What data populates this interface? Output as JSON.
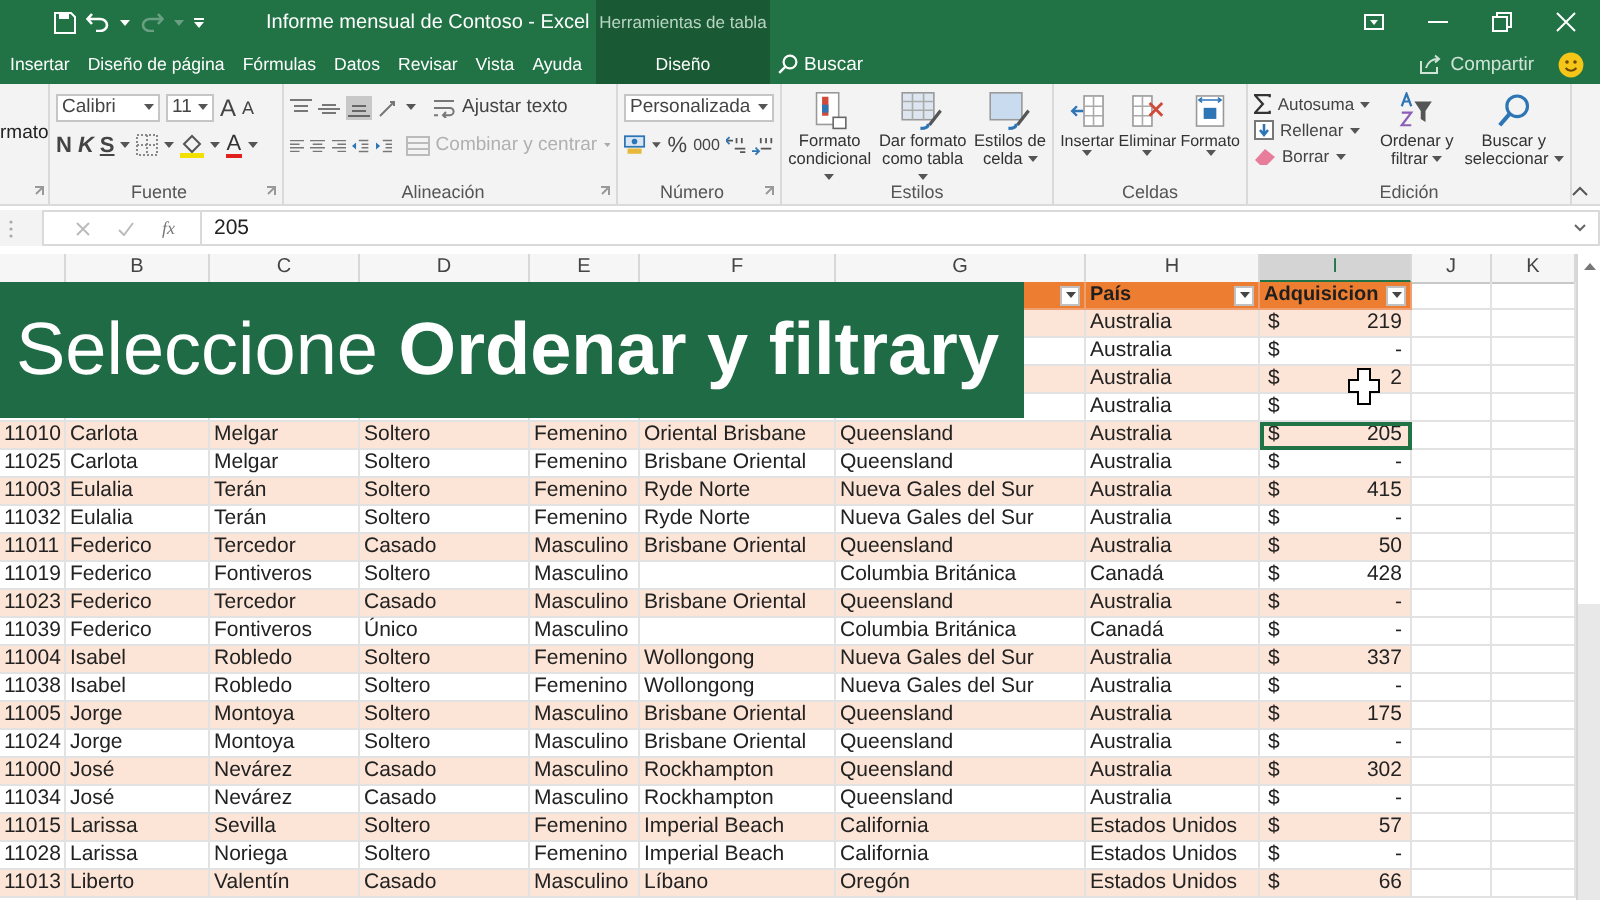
{
  "title_bar": {
    "title": "Informe mensual de Contoso - Excel",
    "context_title": "Herramientas de tabla"
  },
  "tabs": [
    {
      "label": "Insertar",
      "selected": false,
      "kind": "standard"
    },
    {
      "label": "Diseño de página",
      "selected": false,
      "kind": "standard"
    },
    {
      "label": "Fórmulas",
      "selected": false,
      "kind": "standard"
    },
    {
      "label": "Datos",
      "selected": false,
      "kind": "standard"
    },
    {
      "label": "Revisar",
      "selected": false,
      "kind": "standard"
    },
    {
      "label": "Vista",
      "selected": false,
      "kind": "standard"
    },
    {
      "label": "Ayuda",
      "selected": false,
      "kind": "standard"
    },
    {
      "label": "Diseño",
      "selected": false,
      "kind": "contextual"
    }
  ],
  "search": {
    "placeholder": "Buscar"
  },
  "share": {
    "label": "Compartir"
  },
  "ribbon": {
    "cut_label": "rmato",
    "font": {
      "label": "Fuente",
      "font_name": "Calibri",
      "font_size": "11",
      "grow": "A",
      "shrink": "A",
      "bold": "N",
      "italic": "K",
      "underline": "S",
      "font_color": "A"
    },
    "alignment": {
      "label": "Alineación",
      "wrap_text": "Ajustar texto",
      "merge": {
        "label": "Combinar y centrar",
        "disabled": true
      }
    },
    "number": {
      "label": "Número",
      "format": "Personalizada",
      "percent": "%",
      "thousands": "000"
    },
    "styles": {
      "label": "Estilos",
      "buttons": [
        {
          "label": "Formato condicional",
          "kind": "conditional"
        },
        {
          "label": "Dar formato como tabla",
          "kind": "table"
        },
        {
          "label": "Estilos de celda",
          "kind": "cell"
        }
      ]
    },
    "cells": {
      "label": "Celdas",
      "buttons": [
        {
          "label": "Insertar",
          "kind": "insert"
        },
        {
          "label": "Eliminar",
          "kind": "delete"
        },
        {
          "label": "Formato",
          "kind": "format"
        }
      ]
    },
    "editing": {
      "label": "Edición",
      "small_buttons": [
        {
          "label": "Autosuma",
          "kind": "autosum"
        },
        {
          "label": "Rellenar",
          "kind": "fill"
        },
        {
          "label": "Borrar",
          "kind": "clear"
        }
      ],
      "large_buttons": [
        {
          "label": "Ordenar y filtrar",
          "kind": "sort"
        },
        {
          "label": "Buscar y seleccionar",
          "kind": "find"
        }
      ]
    }
  },
  "formula_bar": {
    "function_label": "fx",
    "value": "205"
  },
  "columns": [
    {
      "letter": "B",
      "selected": false
    },
    {
      "letter": "C",
      "selected": false
    },
    {
      "letter": "D",
      "selected": false
    },
    {
      "letter": "E",
      "selected": false
    },
    {
      "letter": "F",
      "selected": false
    },
    {
      "letter": "G",
      "selected": false
    },
    {
      "letter": "H",
      "selected": false
    },
    {
      "letter": "I",
      "selected": true
    },
    {
      "letter": "J",
      "selected": false
    },
    {
      "letter": "K",
      "selected": false
    }
  ],
  "table": {
    "header": [
      {
        "label": "País"
      },
      {
        "label": "Adquisicion"
      }
    ],
    "rows": [
      {
        "country": "Australia",
        "currency": "$",
        "amount": "219",
        "selected": false
      },
      {
        "country": "Australia",
        "currency": "$",
        "amount": "-",
        "selected": false
      },
      {
        "country": "Australia",
        "currency": "$",
        "amount": "2",
        "selected": false
      },
      {
        "country": "Australia",
        "currency": "$",
        "selected": false
      },
      {
        "id": "11010",
        "first_name": "Carlota",
        "last_name": "Melgar",
        "status": "Soltero",
        "gender": "Femenino",
        "city": "Oriental Brisbane",
        "region": "Queensland",
        "country": "Australia",
        "currency": "$",
        "amount": "205",
        "selected": true
      },
      {
        "id": "11025",
        "first_name": "Carlota",
        "last_name": "Melgar",
        "status": "Soltero",
        "gender": "Femenino",
        "city": "Brisbane Oriental",
        "region": "Queensland",
        "country": "Australia",
        "currency": "$",
        "amount": "-",
        "selected": false
      },
      {
        "id": "11003",
        "first_name": "Eulalia",
        "last_name": "Terán",
        "status": "Soltero",
        "gender": "Femenino",
        "city": "Ryde Norte",
        "region": "Nueva Gales del Sur",
        "country": "Australia",
        "currency": "$",
        "amount": "415",
        "selected": false
      },
      {
        "id": "11032",
        "first_name": "Eulalia",
        "last_name": "Terán",
        "status": "Soltero",
        "gender": "Femenino",
        "city": "Ryde Norte",
        "region": "Nueva Gales del Sur",
        "country": "Australia",
        "currency": "$",
        "amount": "-",
        "selected": false
      },
      {
        "id": "11011",
        "first_name": "Federico",
        "last_name": "Tercedor",
        "status": "Casado",
        "gender": "Masculino",
        "city": "Brisbane Oriental",
        "region": "Queensland",
        "country": "Australia",
        "currency": "$",
        "amount": "50",
        "selected": false
      },
      {
        "id": "11019",
        "first_name": "Federico",
        "last_name": "Fontiveros",
        "status": "Soltero",
        "gender": "Masculino",
        "region": "Columbia Británica",
        "country": "Canadá",
        "currency": "$",
        "amount": "428",
        "selected": false
      },
      {
        "id": "11023",
        "first_name": "Federico",
        "last_name": "Tercedor",
        "status": "Casado",
        "gender": "Masculino",
        "city": "Brisbane Oriental",
        "region": "Queensland",
        "country": "Australia",
        "currency": "$",
        "amount": "-",
        "selected": false
      },
      {
        "id": "11039",
        "first_name": "Federico",
        "last_name": "Fontiveros",
        "status": "Único",
        "gender": "Masculino",
        "region": "Columbia Británica",
        "country": "Canadá",
        "currency": "$",
        "amount": "-",
        "selected": false
      },
      {
        "id": "11004",
        "first_name": "Isabel",
        "last_name": "Robledo",
        "status": "Soltero",
        "gender": "Femenino",
        "city": "Wollongong",
        "region": "Nueva Gales del Sur",
        "country": "Australia",
        "currency": "$",
        "amount": "337",
        "selected": false
      },
      {
        "id": "11038",
        "first_name": "Isabel",
        "last_name": "Robledo",
        "status": "Soltero",
        "gender": "Femenino",
        "city": "Wollongong",
        "region": "Nueva Gales del Sur",
        "country": "Australia",
        "currency": "$",
        "amount": "-",
        "selected": false
      },
      {
        "id": "11005",
        "first_name": "Jorge",
        "last_name": "Montoya",
        "status": "Soltero",
        "gender": "Masculino",
        "city": "Brisbane Oriental",
        "region": "Queensland",
        "country": "Australia",
        "currency": "$",
        "amount": "175",
        "selected": false
      },
      {
        "id": "11024",
        "first_name": "Jorge",
        "last_name": "Montoya",
        "status": "Soltero",
        "gender": "Masculino",
        "city": "Brisbane Oriental",
        "region": "Queensland",
        "country": "Australia",
        "currency": "$",
        "amount": "-",
        "selected": false
      },
      {
        "id": "11000",
        "first_name": "José",
        "last_name": "Nevárez",
        "status": "Casado",
        "gender": "Masculino",
        "city": "Rockhampton",
        "region": "Queensland",
        "country": "Australia",
        "currency": "$",
        "amount": "302",
        "selected": false
      },
      {
        "id": "11034",
        "first_name": "José",
        "last_name": "Nevárez",
        "status": "Casado",
        "gender": "Masculino",
        "city": "Rockhampton",
        "region": "Queensland",
        "country": "Australia",
        "currency": "$",
        "amount": "-",
        "selected": false
      },
      {
        "id": "11015",
        "first_name": "Larissa",
        "last_name": "Sevilla",
        "status": "Soltero",
        "gender": "Femenino",
        "city": "Imperial Beach",
        "region": "California",
        "country": "Estados Unidos",
        "currency": "$",
        "amount": "57",
        "selected": false
      },
      {
        "id": "11028",
        "first_name": "Larissa",
        "last_name": "Noriega",
        "status": "Soltero",
        "gender": "Femenino",
        "city": "Imperial Beach",
        "region": "California",
        "country": "Estados Unidos",
        "currency": "$",
        "amount": "-",
        "selected": false
      },
      {
        "id": "11013",
        "first_name": "Liberto",
        "last_name": "Valentín",
        "status": "Casado",
        "gender": "Masculino",
        "city": "Líbano",
        "region": "Oregón",
        "country": "Estados Unidos",
        "currency": "$",
        "amount": "66",
        "selected": false
      }
    ]
  },
  "banner": {
    "text": "Seleccione **Ordenar y filtrary**"
  }
}
